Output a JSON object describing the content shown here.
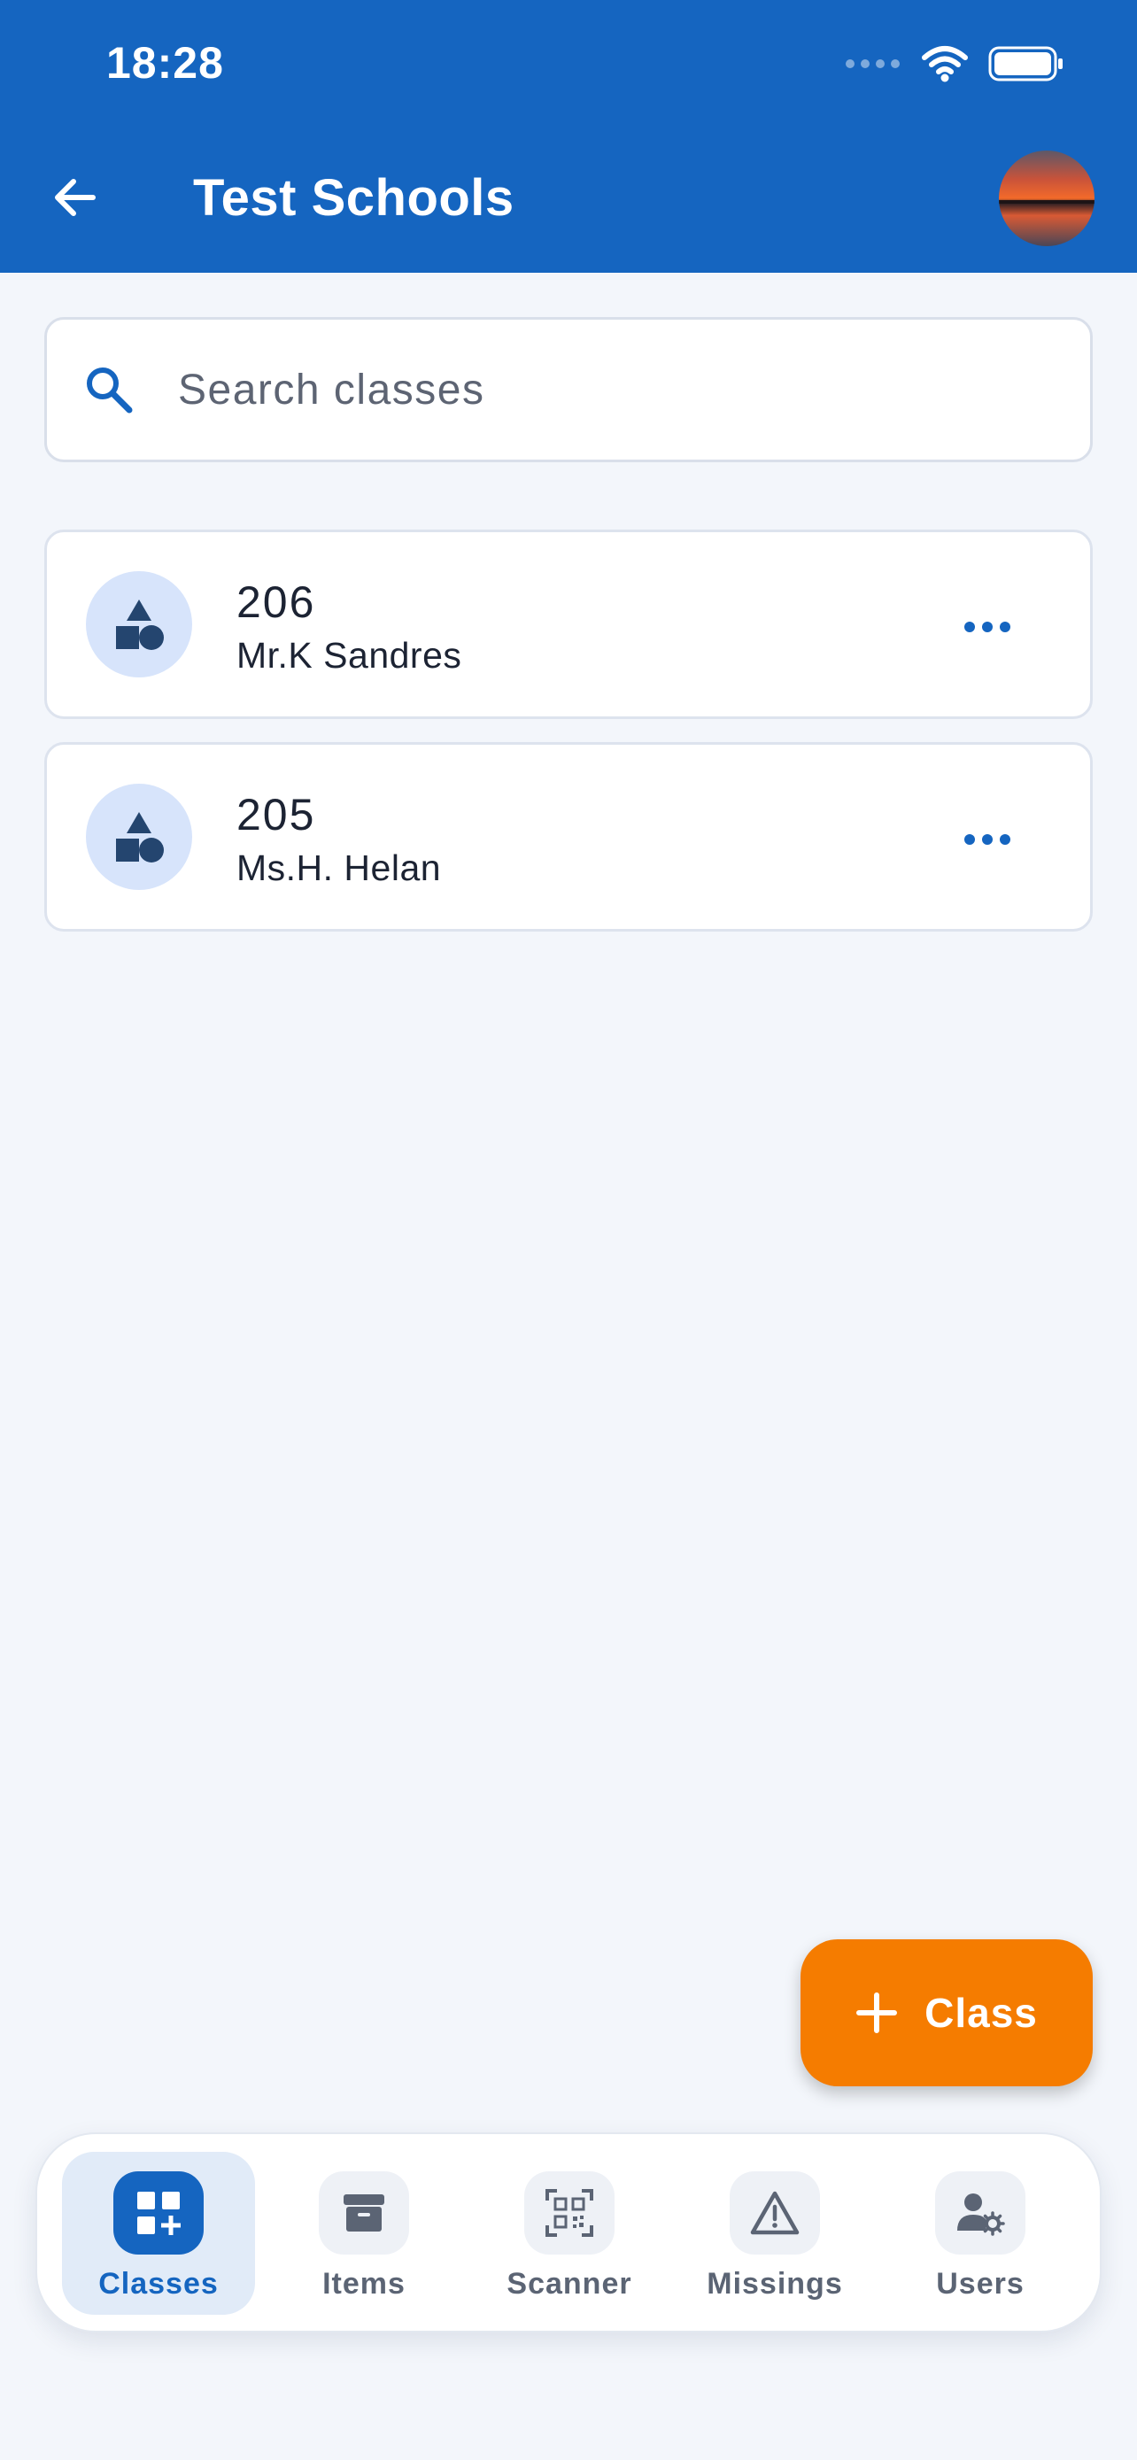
{
  "status_bar": {
    "time": "18:28"
  },
  "header": {
    "title": "Test Schools",
    "back_icon": "arrow-left-icon",
    "avatar": "sunset-photo-avatar"
  },
  "search": {
    "placeholder": "Search classes",
    "value": "",
    "icon": "search-icon"
  },
  "classes": [
    {
      "number": "206",
      "teacher": "Mr.K Sandres",
      "icon": "shapes-icon",
      "menu_icon": "more-horizontal-icon"
    },
    {
      "number": "205",
      "teacher": "Ms.H. Helan",
      "icon": "shapes-icon",
      "menu_icon": "more-horizontal-icon"
    }
  ],
  "fab": {
    "label": "Class",
    "icon": "plus-icon"
  },
  "bottom_nav": {
    "active": "Classes",
    "items": [
      {
        "label": "Classes",
        "icon": "grid-add-icon"
      },
      {
        "label": "Items",
        "icon": "archive-box-icon"
      },
      {
        "label": "Scanner",
        "icon": "qr-scan-icon"
      },
      {
        "label": "Missings",
        "icon": "warning-triangle-icon"
      },
      {
        "label": "Users",
        "icon": "user-settings-icon"
      }
    ]
  },
  "colors": {
    "primary": "#1565c0",
    "accent": "#f57c00",
    "background": "#f3f6fb",
    "card": "#ffffff",
    "icon_circle": "#d7e4fb"
  }
}
